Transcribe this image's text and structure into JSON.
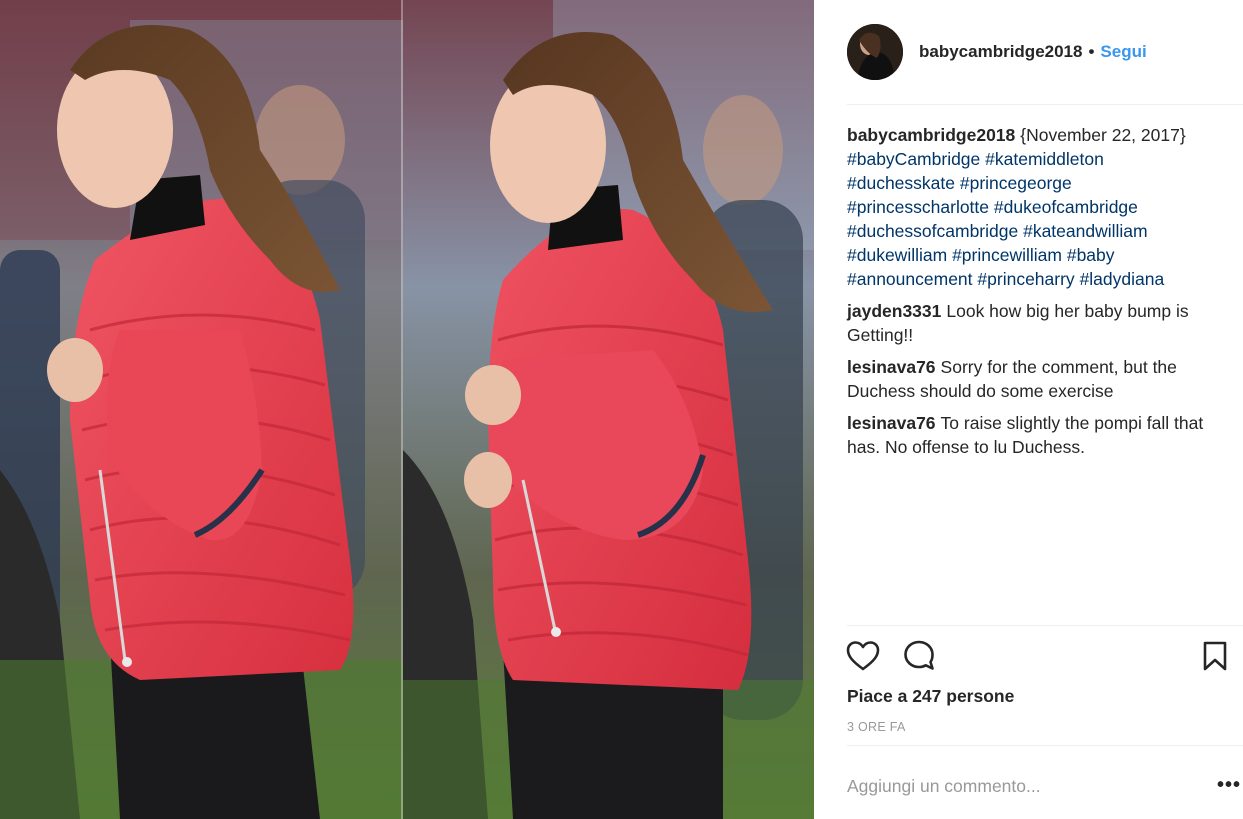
{
  "post": {
    "author": "babycambridge2018",
    "separator": "•",
    "follow_label": "Segui",
    "caption": {
      "author": "babycambridge2018",
      "text": "{November 22, 2017}",
      "hashtags": [
        "#babyCambridge",
        "#katemiddleton",
        "#duchesskate",
        "#princegeorge",
        "#princesscharlotte",
        "#dukeofcambridge",
        "#duchessofcambridge",
        "#kateandwilliam",
        "#dukewilliam",
        "#princewilliam",
        "#baby",
        "#announcement",
        "#princeharry",
        "#ladydiana"
      ]
    },
    "comments": [
      {
        "author": "jayden3331",
        "text": "Look how big her baby bump is Getting!!"
      },
      {
        "author": "lesinava76",
        "text": "Sorry for the comment, but the Duchess should do some exercise"
      },
      {
        "author": "lesinava76",
        "text": "To raise slightly the pompi fall that has. No offense to lu Duchess."
      }
    ],
    "likes_text": "Piace a 247 persone",
    "timestamp": "3 ORE FA",
    "add_comment_placeholder": "Aggiungi un commento...",
    "more_label": "•••"
  },
  "icons": {
    "like": "heart-icon",
    "comment": "comment-bubble-icon",
    "save": "bookmark-icon",
    "more": "more-options-icon"
  },
  "colors": {
    "link_blue": "#3897f0",
    "hashtag_blue": "#003569",
    "muted_gray": "#999999",
    "jacket_red": "#e63b4c"
  }
}
